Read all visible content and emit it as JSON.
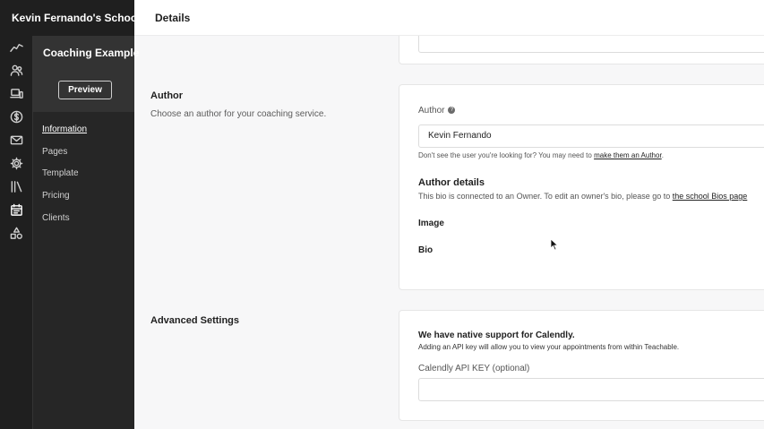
{
  "header": {
    "school_name": "Kevin Fernando's School",
    "page_title": "Details"
  },
  "icon_rail": [
    {
      "name": "analytics-icon"
    },
    {
      "name": "users-icon"
    },
    {
      "name": "devices-icon"
    },
    {
      "name": "dollar-icon"
    },
    {
      "name": "mail-icon"
    },
    {
      "name": "settings-gear-icon"
    },
    {
      "name": "library-icon"
    },
    {
      "name": "calendar-icon",
      "active": true
    },
    {
      "name": "shapes-icon"
    }
  ],
  "subnav": {
    "course_name": "Coaching Example",
    "preview_label": "Preview",
    "items": [
      {
        "label": "Information",
        "active": true
      },
      {
        "label": "Pages"
      },
      {
        "label": "Template"
      },
      {
        "label": "Pricing"
      },
      {
        "label": "Clients"
      }
    ]
  },
  "author_section": {
    "title": "Author",
    "description": "Choose an author for your coaching service.",
    "field_label": "Author",
    "field_value": "Kevin Fernando",
    "hint_text": "Don't see the user you're looking for? You may need to ",
    "hint_link": "make them an Author",
    "hint_end": ".",
    "details_title": "Author details",
    "details_text": "This bio is connected to an Owner. To edit an owner's bio, please go to ",
    "details_link": "the school Bios page",
    "image_label": "Image",
    "bio_label": "Bio"
  },
  "advanced_section": {
    "title": "Advanced Settings",
    "calendly_title": "We have native support for Calendly.",
    "calendly_desc": "Adding an API key will allow you to view your appointments from within Teachable.",
    "api_key_label": "Calendly API KEY (optional)",
    "api_key_value": "",
    "api_key_placeholder": ""
  }
}
